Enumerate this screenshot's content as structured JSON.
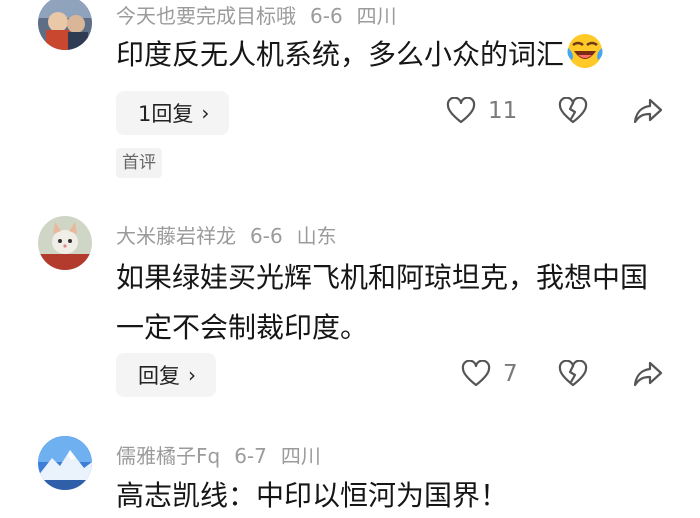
{
  "comments": [
    {
      "username": "今天也要完成目标哦",
      "date": "6-6",
      "location": "四川",
      "text": "印度反无人机系统，多么小众的词汇",
      "reply_label": "1回复",
      "like_count": "11",
      "tag": "首评",
      "avatar": "user-photo"
    },
    {
      "username": "大米藤岩祥龙",
      "date": "6-6",
      "location": "山东",
      "text": "如果绿娃买光辉飞机和阿琼坦克，我想中国一定不会制裁印度。",
      "reply_label": "回复",
      "like_count": "7",
      "avatar": "cat-photo"
    },
    {
      "username": "儒雅橘子Fq",
      "date": "6-7",
      "location": "四川",
      "text": "高志凯线：中印以恒河为国界！",
      "avatar": "mountain-photo"
    }
  ],
  "icons": {
    "like": "heart-outline-icon",
    "dislike": "broken-heart-icon",
    "share": "share-arrow-icon",
    "reply_chevron": "chevron-right-icon",
    "emoji": "laughing-crying-emoji"
  },
  "chevron": "›"
}
